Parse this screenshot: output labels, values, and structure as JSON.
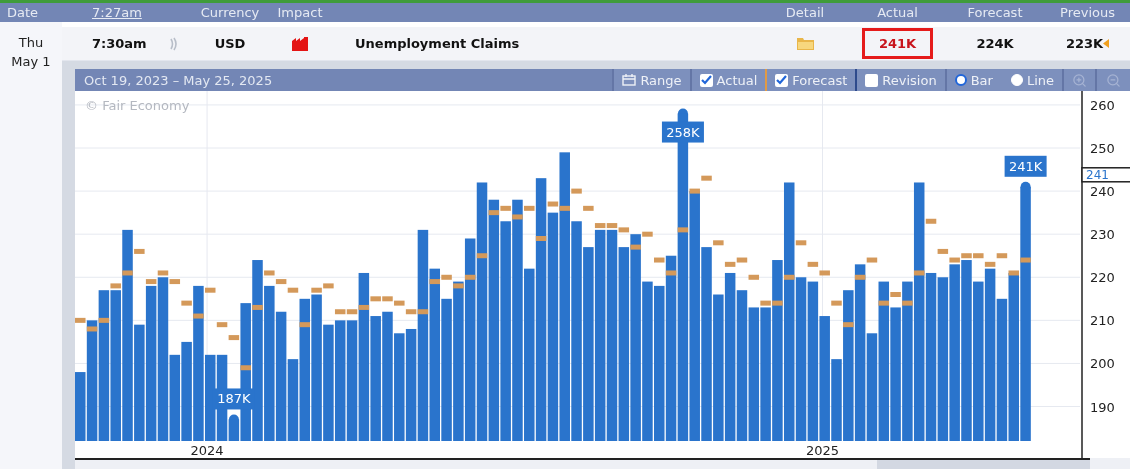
{
  "header": {
    "columns": [
      {
        "label": "Date",
        "kind": "label"
      },
      {
        "label": "7:27am",
        "kind": "link"
      },
      {
        "label": "Currency",
        "kind": "label"
      },
      {
        "label": "Impact",
        "kind": "label"
      },
      {
        "label": "Detail",
        "kind": "label"
      },
      {
        "label": "Actual",
        "kind": "label"
      },
      {
        "label": "Forecast",
        "kind": "label"
      },
      {
        "label": "Previous",
        "kind": "label"
      }
    ]
  },
  "event": {
    "day": "Thu",
    "date": "May 1",
    "time": "7:30am",
    "currency": "USD",
    "title": "Unemployment Claims",
    "actual": "241K",
    "actual_highlighted": true,
    "forecast": "224K",
    "previous": "223K",
    "previous_revised": true
  },
  "chart": {
    "range": "Oct 19, 2023 – May 25, 2025",
    "controls": [
      {
        "kind": "button",
        "label": "Range"
      },
      {
        "kind": "series_checkbox",
        "checked": true
      },
      {
        "kind": "series_checkbox",
        "checked": true
      },
      {
        "kind": "checkbox",
        "label": "Revision",
        "checked": false
      },
      {
        "kind": "radio",
        "label": "Bar",
        "selected": true
      },
      {
        "kind": "radio",
        "label": "Line",
        "selected": false
      },
      {
        "kind": "zoom-in"
      },
      {
        "kind": "zoom-out"
      }
    ],
    "credit": "© Fair Economy",
    "current_label": "241",
    "chart_data": {
      "type": "bar",
      "grid": true,
      "xlim": [
        2023.7854,
        2025.4184
      ],
      "ylim": [
        182,
        263
      ],
      "yticks": [
        190,
        200,
        210,
        220,
        230,
        240,
        250,
        260
      ],
      "x": [
        2023.795,
        2023.8142,
        2023.8334,
        2023.8526,
        2023.8718,
        2023.891,
        2023.9102,
        2023.9294,
        2023.9486,
        2023.9678,
        2023.987,
        2024.0062,
        2024.0254,
        2024.0446,
        2024.0638,
        2024.083,
        2024.1022,
        2024.1214,
        2024.1406,
        2024.1598,
        2024.179,
        2024.1982,
        2024.2174,
        2024.2366,
        2024.2558,
        2024.275,
        2024.2942,
        2024.3134,
        2024.3326,
        2024.3518,
        2024.371,
        2024.3902,
        2024.4094,
        2024.4286,
        2024.4478,
        2024.467,
        2024.4862,
        2024.5054,
        2024.5246,
        2024.5438,
        2024.563,
        2024.5822,
        2024.6014,
        2024.6206,
        2024.6398,
        2024.659,
        2024.6782,
        2024.6974,
        2024.7166,
        2024.7358,
        2024.755,
        2024.7742,
        2024.7934,
        2024.8126,
        2024.8318,
        2024.851,
        2024.8702,
        2024.8894,
        2024.9086,
        2024.9278,
        2024.947,
        2024.9662,
        2024.9854,
        2025.0046,
        2025.0238,
        2025.043,
        2025.0622,
        2025.0814,
        2025.1006,
        2025.1198,
        2025.139,
        2025.1582,
        2025.1774,
        2025.1966,
        2025.2158,
        2025.235,
        2025.2542,
        2025.2734,
        2025.2926,
        2025.3118,
        2025.331
      ],
      "xticks": [
        {
          "value": 2024,
          "label": "2024"
        },
        {
          "value": 2025,
          "label": "2025"
        }
      ],
      "series": [
        {
          "name": "Actual",
          "color": "#2a74cc",
          "values": [
            198,
            210,
            217,
            217,
            231,
            209,
            218,
            220,
            202,
            205,
            218,
            202,
            202,
            187,
            214,
            224,
            218,
            212,
            201,
            215,
            216,
            209,
            210,
            210,
            221,
            211,
            212,
            207,
            208,
            231,
            222,
            215,
            219,
            229,
            242,
            238,
            233,
            238,
            222,
            243,
            235,
            249,
            233,
            227,
            231,
            231,
            227,
            230,
            219,
            218,
            225,
            258,
            240,
            227,
            216,
            221,
            217,
            213,
            213,
            224,
            242,
            220,
            219,
            211,
            201,
            217,
            223,
            207,
            219,
            213,
            219,
            242,
            221,
            220,
            223,
            224,
            219,
            222,
            215,
            221,
            241
          ]
        },
        {
          "name": "Forecast",
          "type": "scatter",
          "color": "#d4995a",
          "values": [
            210,
            208,
            210,
            218,
            221,
            226,
            219,
            221,
            219,
            214,
            211,
            217,
            209,
            206,
            199,
            213,
            221,
            219,
            217,
            209,
            217,
            218,
            212,
            212,
            213,
            215,
            215,
            214,
            212,
            212,
            219,
            220,
            218,
            220,
            225,
            235,
            236,
            234,
            236,
            229,
            237,
            236,
            240,
            236,
            232,
            232,
            231,
            227,
            230,
            224,
            221,
            231,
            240,
            243,
            228,
            223,
            224,
            220,
            214,
            214,
            220,
            228,
            223,
            221,
            214,
            209,
            220,
            224,
            214,
            216,
            214,
            221,
            233,
            226,
            224,
            225,
            225,
            223,
            225,
            221,
            224
          ]
        }
      ],
      "annotations": [
        {
          "x": 2024.0446,
          "y": 187,
          "text": "187K"
        },
        {
          "x": 2024.7742,
          "y": 258,
          "text": "258K"
        },
        {
          "x": 2025.331,
          "y": 241,
          "text": "241K"
        }
      ]
    }
  }
}
